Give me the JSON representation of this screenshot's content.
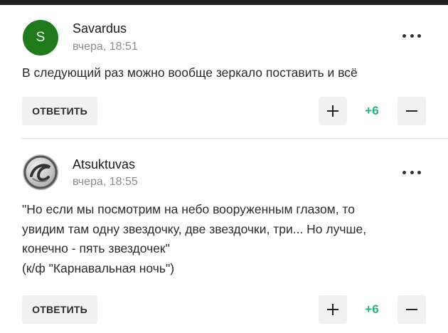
{
  "comments": [
    {
      "avatar_letter": "S",
      "author": "Savardus",
      "time": "вчера, 18:51",
      "text_lines": [
        "В следующий раз можно вообще зеркало поставить и всё"
      ],
      "reply_label": "ОТВЕТИТЬ",
      "score": "+6"
    },
    {
      "author": "Atsuktuvas",
      "time": "вчера, 18:55",
      "text_lines": [
        "\"Но если мы посмотрим на небо вооруженным глазом, то",
        "увидим там одну звездочку, две звездочки, три... Но лучше,",
        "конечно - пять звездочек\"",
        "(к/ф \"Карнавальная ночь\")"
      ],
      "reply_label": "ОТВЕТИТЬ",
      "score": "+6"
    }
  ],
  "colors": {
    "score": "#23b37a",
    "avatar_bg": "#1f7a1a"
  },
  "icons": [
    "more-icon",
    "plus-icon",
    "minus-icon"
  ]
}
